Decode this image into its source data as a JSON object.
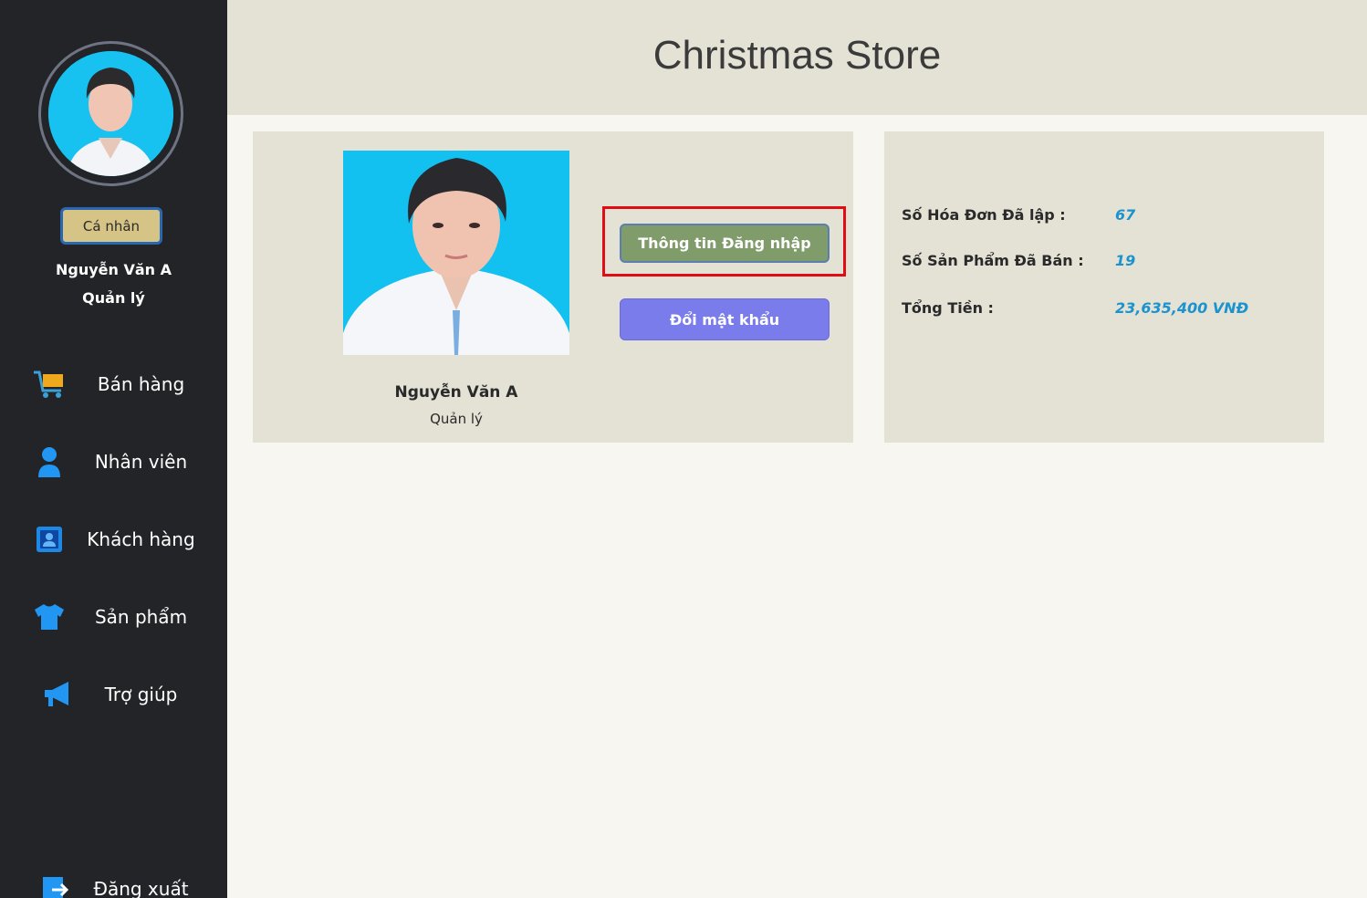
{
  "app": {
    "title": "Christmas Store"
  },
  "sidebar": {
    "personal_button": "Cá nhân",
    "user_name": "Nguyễn Văn A",
    "user_role": "Quản lý",
    "items": [
      {
        "label": "Bán hàng",
        "icon": "cart-icon"
      },
      {
        "label": "Nhân viên",
        "icon": "person-icon"
      },
      {
        "label": "Khách hàng",
        "icon": "contact-card-icon"
      },
      {
        "label": "Sản phẩm",
        "icon": "shirt-icon"
      },
      {
        "label": "Trợ giúp",
        "icon": "megaphone-icon"
      }
    ],
    "logout": {
      "label": "Đăng xuất",
      "icon": "logout-icon"
    }
  },
  "profile": {
    "name": "Nguyễn Văn A",
    "role": "Quản lý",
    "login_info_button": "Thông tin Đăng nhập",
    "change_password_button": "Đổi mật khẩu"
  },
  "stats": {
    "invoices_label": "Số Hóa Đơn Đã lập :",
    "invoices_value": "67",
    "products_sold_label": "Số Sản Phẩm Đã Bán :",
    "products_sold_value": "19",
    "total_label": "Tổng Tiền :",
    "total_value": "23,635,400 VNĐ"
  },
  "colors": {
    "sidebar_bg": "#232427",
    "panel_bg": "#e4e1d5",
    "accent_blue": "#1a93cf",
    "login_button": "#7f9c6a",
    "change_pw_button": "#7a7ceb",
    "highlight_border": "#e00d15"
  }
}
